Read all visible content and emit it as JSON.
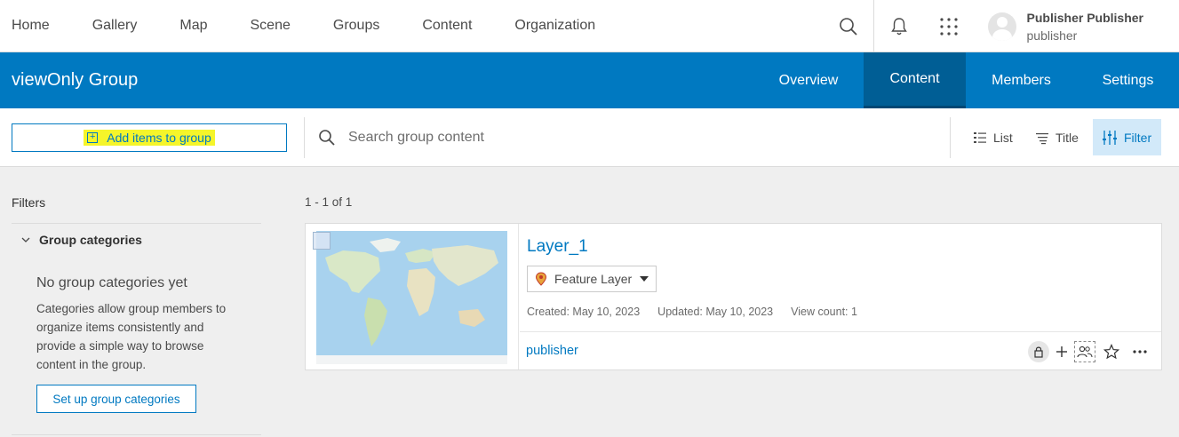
{
  "topnav": {
    "items": [
      "Home",
      "Gallery",
      "Map",
      "Scene",
      "Groups",
      "Content",
      "Organization"
    ],
    "icons": [
      "search-icon",
      "bell-icon",
      "apps-grid-icon"
    ],
    "user": {
      "name": "Publisher Publisher",
      "username": "publisher"
    }
  },
  "group": {
    "title": "viewOnly Group",
    "tabs": [
      "Overview",
      "Content",
      "Members",
      "Settings"
    ],
    "active_tab": "Content",
    "brand_color": "#0079c1"
  },
  "toolbar": {
    "add_label": "Add items to group",
    "search_placeholder": "Search group content",
    "view_list": "List",
    "sort_title": "Title",
    "filter": "Filter"
  },
  "filters": {
    "title": "Filters",
    "category_heading": "Group categories",
    "empty_title": "No group categories yet",
    "empty_desc": "Categories allow group members to organize items consistently and provide a simple way to browse content in the group.",
    "setup_label": "Set up group categories"
  },
  "results": {
    "count": "1 - 1 of 1",
    "items": [
      {
        "title": "Layer_1",
        "type": "Feature Layer",
        "created": "Created: May 10, 2023",
        "updated": "Updated: May 10, 2023",
        "views": "View count: 1",
        "owner": "publisher"
      }
    ]
  }
}
